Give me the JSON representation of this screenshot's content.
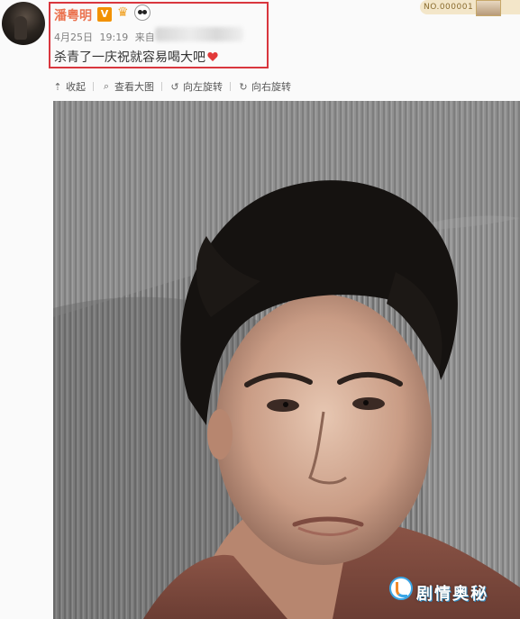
{
  "post": {
    "username": "潘粤明",
    "verified_badge": "V",
    "badges": [
      "crown-icon",
      "panda-icon"
    ],
    "date": "4月25日",
    "time": "19:19",
    "source_prefix": "来自",
    "text": "杀青了一庆祝就容易喝大吧",
    "emoji": "heart-icon"
  },
  "id_badge": {
    "label": "NO.000001"
  },
  "toolbar": {
    "collapse": "收起",
    "view_large": "查看大图",
    "rotate_left": "向左旋转",
    "rotate_right": "向右旋转"
  },
  "watermark": {
    "text": "剧情奥秘"
  },
  "colors": {
    "username": "#eb7350",
    "highlight_box": "#d9363e",
    "verified": "#f29100"
  }
}
